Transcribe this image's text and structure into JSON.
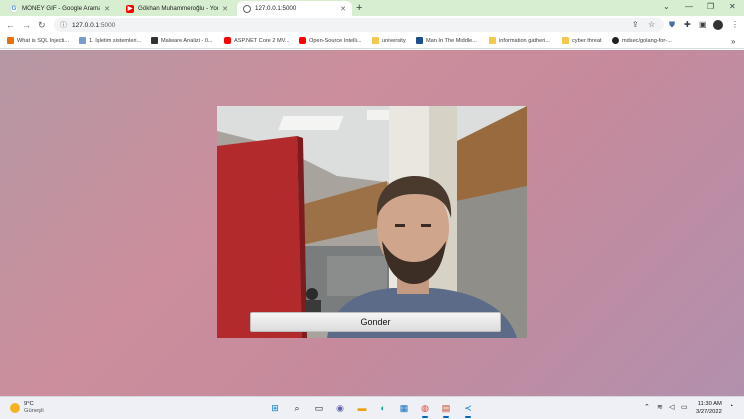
{
  "browser": {
    "tabs": [
      {
        "title": "MONEY GIF - Google Arama",
        "favicon": "google-icon",
        "active": false
      },
      {
        "title": "Gökhan Muhammeroğlu - YouTub",
        "favicon": "youtube-icon",
        "active": false
      },
      {
        "title": "127.0.0.1:5000",
        "favicon": "globe-icon",
        "active": true
      }
    ],
    "new_tab_glyph": "+",
    "window_controls": [
      "⌄",
      "—",
      "❐",
      "✕"
    ],
    "address": {
      "host": "127.0.0.1",
      "port": ":5000"
    },
    "bookmarks": [
      {
        "label": "What is SQL Injecti...",
        "icon": "bookmark-site-icon",
        "color": "#e8710a"
      },
      {
        "label": "1. İşletim sistemleri...",
        "icon": "bookmark-site-icon",
        "color": "#7b9bd0"
      },
      {
        "label": "Malware Analizi - 0...",
        "icon": "bookmark-site-icon",
        "color": "#333333"
      },
      {
        "label": "ASP.NET Core 2 MV...",
        "icon": "youtube-icon",
        "color": "#ff0000"
      },
      {
        "label": "Open-Source Intelli...",
        "icon": "youtube-icon",
        "color": "#ff0000"
      },
      {
        "label": "university",
        "icon": "folder-icon",
        "color": "#f2c94c"
      },
      {
        "label": "Man In The Middle...",
        "icon": "bookmark-site-icon",
        "color": "#1f4e8c"
      },
      {
        "label": "information gatheri...",
        "icon": "folder-icon",
        "color": "#f2c94c"
      },
      {
        "label": "cyber threat",
        "icon": "folder-icon",
        "color": "#f2c94c"
      },
      {
        "label": "mdsec/golang-for-...",
        "icon": "github-icon",
        "color": "#222222"
      }
    ],
    "bookmarks_more": "»"
  },
  "page": {
    "send_button_label": "Gonder"
  },
  "taskbar": {
    "weather_temp": "9°C",
    "weather_desc": "Güneşli",
    "time": "11:30 AM",
    "date": "3/27/2022"
  },
  "colors": {
    "tab_strip": "#d7efd0",
    "page_gradient_start": "#b598a4",
    "page_gradient_end": "#b290ad"
  }
}
